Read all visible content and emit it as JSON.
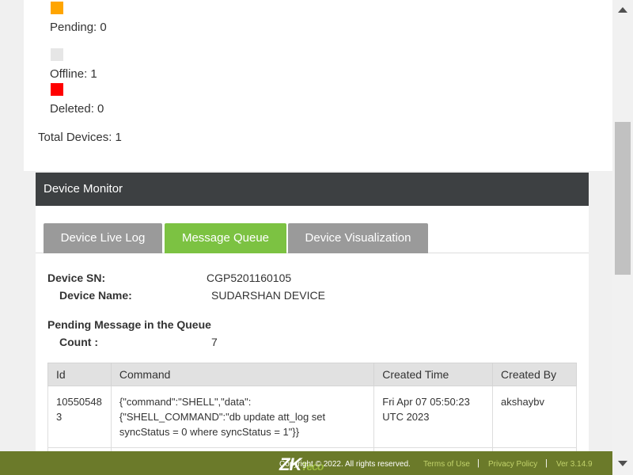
{
  "status": {
    "legend": [
      {
        "label": "Pending: 0",
        "color": "#ffa500"
      },
      {
        "label": "Offline: 1",
        "color": "#e6e6e6"
      },
      {
        "label": "Deleted: 0",
        "color": "#ff0000"
      }
    ],
    "total": "Total Devices: 1"
  },
  "monitor": {
    "title": "Device Monitor",
    "tabs": [
      {
        "label": "Device Live Log",
        "active": false
      },
      {
        "label": "Message Queue",
        "active": true
      },
      {
        "label": "Device Visualization",
        "active": false
      }
    ],
    "device_sn_label": "Device SN:",
    "device_sn": "CGP5201160105",
    "device_name_label": "Device Name:",
    "device_name": "SUDARSHAN DEVICE",
    "pending_heading": "Pending Message in the Queue",
    "count_label": "Count :",
    "count": "7",
    "table": {
      "columns": [
        "Id",
        "Command",
        "Created Time",
        "Created By"
      ],
      "rows": [
        {
          "id": "105505483",
          "command": "{\"command\":\"SHELL\",\"data\":{\"SHELL_COMMAND\":\"db update att_log set syncStatus = 0 where syncStatus = 1\"}}",
          "created_time": "Fri Apr 07 05:50:23 UTC 2023",
          "created_by": "akshaybv"
        }
      ]
    }
  },
  "footer": {
    "logo_zk": "ZK",
    "logo_eco": "Teco",
    "copyright": "Copyright © 2022. All rights reserved.",
    "terms": "Terms of Use",
    "privacy": "Privacy Policy",
    "version": "Ver 3.14.9",
    "separator": "|"
  },
  "colors": {
    "tab_active": "#7cc242",
    "tab_inactive": "#9a9a9a",
    "header_bg": "#3d4042",
    "footer_bg": "#6b7a2a"
  }
}
